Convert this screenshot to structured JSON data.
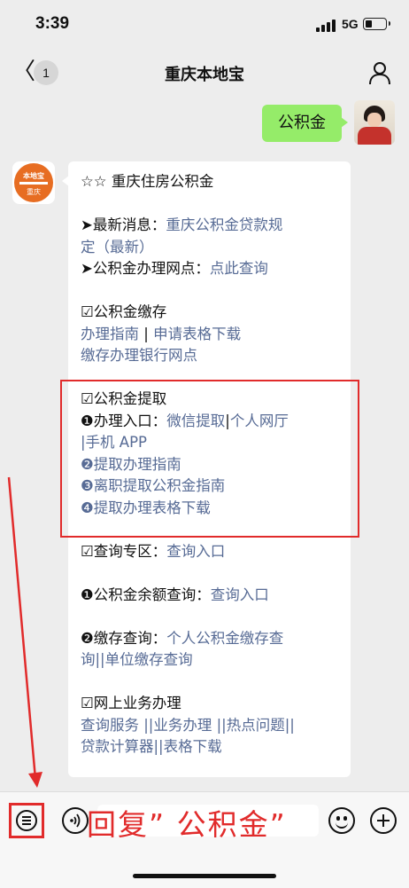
{
  "status": {
    "time": "3:39",
    "network": "5G"
  },
  "nav": {
    "back_glyph": "〈",
    "unread_count": "1",
    "title": "重庆本地宝"
  },
  "outgoing": {
    "text": "公积金"
  },
  "bot": {
    "logo_text": "本地宝",
    "logo_city": "重庆"
  },
  "reply": {
    "header": "☆☆ 重庆住房公积金",
    "news_label": "➤最新消息：",
    "news_link_1": "重庆公积金贷款规",
    "news_link_2": "定（最新）",
    "outlet_label": "➤公积金办理网点：",
    "outlet_link": "点此查询",
    "deposit_title": "☑公积金缴存",
    "deposit_link_guide": "办理指南",
    "deposit_sep": " | ",
    "deposit_link_forms": "申请表格下载",
    "deposit_link_banks": "缴存办理银行网点",
    "withdraw_title": "☑公积金提取",
    "withdraw_entry_label": "❶办理入口：",
    "withdraw_entry_wechat": "微信提取",
    "withdraw_entry_sep": "|",
    "withdraw_entry_hall": "个人网厅",
    "withdraw_entry_app": "|手机 APP",
    "withdraw_item_2": "❷提取办理指南",
    "withdraw_item_3": "❸离职提取公积金指南",
    "withdraw_item_4": "❹提取办理表格下载",
    "query_label": "☑查询专区：",
    "query_link": "查询入口",
    "balance_label": "❶公积金余额查询：",
    "balance_link": "查询入口",
    "deposit_query_label": "❷缴存查询：",
    "deposit_query_link_1": "个人公积金缴存查",
    "deposit_query_link_2": "询||单位缴存查询",
    "online_title": "☑网上业务办理",
    "online_links_1": "查询服务 ||业务办理 ||热点问题||",
    "online_links_2": "贷款计算器||表格下载"
  },
  "annotation": {
    "reply_hint": "回复” 公积金”"
  },
  "colors": {
    "link": "#576b95",
    "bubble_out": "#95ec69",
    "annotation": "#e12b2b"
  }
}
